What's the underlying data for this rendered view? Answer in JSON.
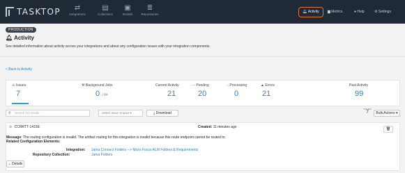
{
  "topnav": {
    "brand": "TASKTOP",
    "items": [
      {
        "label": "Integrations",
        "icon": "integrations-icon"
      },
      {
        "label": "Collections",
        "icon": "collections-icon"
      },
      {
        "label": "Models",
        "icon": "models-icon"
      },
      {
        "label": "Repositories",
        "icon": "repositories-icon"
      }
    ],
    "right": {
      "activity": "Activity",
      "metrics": "Metrics",
      "help": "Help",
      "settings": "Settings"
    },
    "accent": "#e8743b"
  },
  "page": {
    "badge": "PRODUCTION",
    "title": "Activity",
    "description": "See detailed information about activity across your integrations and about any configuration issues with your integration components.",
    "back_link": "< Back to Activity"
  },
  "stats": {
    "issues": {
      "label": "Issues",
      "value": "7"
    },
    "background_jobs": {
      "label": "Background Jobs",
      "value": "0",
      "total": "/ 84"
    },
    "current_activity": {
      "label": "Current Activity",
      "value": "21"
    },
    "pending": {
      "label": "Pending",
      "value": "20"
    },
    "processing": {
      "label": "Processing",
      "value": "0"
    },
    "errors": {
      "label": "Errors",
      "value": "21"
    },
    "past_activity": {
      "label": "Past Activity",
      "value": "99"
    }
  },
  "toolbar": {
    "search_placeholder": "Search list results",
    "impact_placeholder": "Select Issue Impact",
    "download": "Download",
    "issues_label": "ISSUES",
    "issues_count": "7",
    "bulk_actions": "Bulk Actions"
  },
  "issue": {
    "id": "CCRRTT-1415E",
    "created_label": "Created:",
    "created_value": "11 minutes ago",
    "message_label": "Message:",
    "message": "The routing configuration is invalid. The artifact routing for this integration is invalid because this route endpoint cannot be routed to.",
    "related": "Related Configuration Elements:",
    "integration_label": "Integration:",
    "integration_value": "Jama Connect Folders --> Micro Focus ALM Folders & Requirements",
    "repo_label": "Repository Collection:",
    "repo_value": "Jama Folders",
    "details": "Details"
  }
}
